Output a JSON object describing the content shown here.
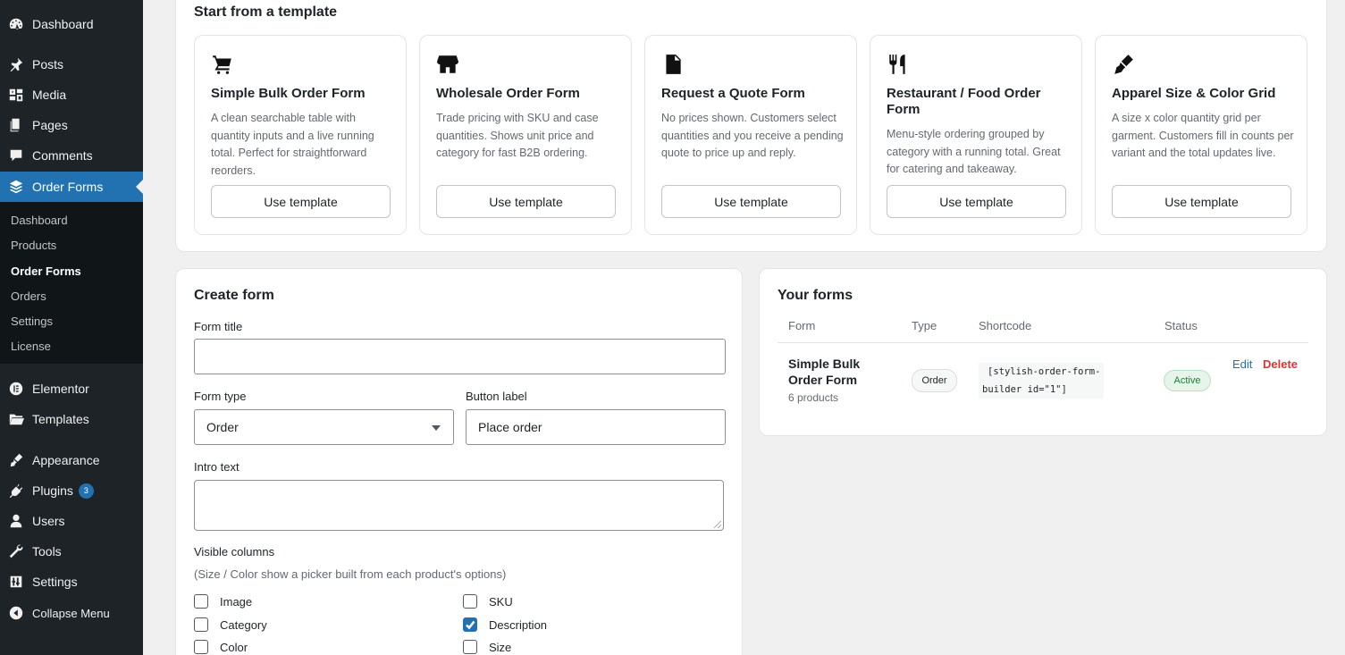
{
  "sidebar": {
    "items": [
      {
        "label": "Dashboard",
        "icon": "dashboard-icon"
      },
      {
        "label": "Posts",
        "icon": "pin-icon"
      },
      {
        "label": "Media",
        "icon": "media-icon"
      },
      {
        "label": "Pages",
        "icon": "pages-icon"
      },
      {
        "label": "Comments",
        "icon": "comment-icon"
      },
      {
        "label": "Order Forms",
        "icon": "stack-icon"
      },
      {
        "label": "Elementor",
        "icon": "elementor-icon"
      },
      {
        "label": "Templates",
        "icon": "folder-icon"
      },
      {
        "label": "Appearance",
        "icon": "brush-icon"
      },
      {
        "label": "Plugins",
        "icon": "plugin-icon",
        "badge": "3"
      },
      {
        "label": "Users",
        "icon": "user-icon"
      },
      {
        "label": "Tools",
        "icon": "wrench-icon"
      },
      {
        "label": "Settings",
        "icon": "settings-icon"
      },
      {
        "label": "Collapse Menu",
        "icon": "collapse-icon"
      }
    ],
    "submenu": [
      "Dashboard",
      "Products",
      "Order Forms",
      "Orders",
      "Settings",
      "License"
    ]
  },
  "templates": {
    "title": "Start from a template",
    "cards": [
      {
        "name": "Simple Bulk Order Form",
        "icon": "cart-icon",
        "desc": "A clean searchable table with quantity inputs and a live running total. Perfect for straightforward reorders.",
        "button": "Use template"
      },
      {
        "name": "Wholesale Order Form",
        "icon": "store-icon",
        "desc": "Trade pricing with SKU and case quantities. Shows unit price and category for fast B2B ordering.",
        "button": "Use template"
      },
      {
        "name": "Request a Quote Form",
        "icon": "document-icon",
        "desc": "No prices shown. Customers select quantities and you receive a pending quote to price up and reply.",
        "button": "Use template"
      },
      {
        "name": "Restaurant / Food Order Form",
        "icon": "utensils-icon",
        "desc": "Menu-style ordering grouped by category with a running total. Great for catering and takeaway.",
        "button": "Use template"
      },
      {
        "name": "Apparel Size & Color Grid",
        "icon": "brush-icon",
        "desc": "A size x color quantity grid per garment. Customers fill in counts per variant and the total updates live.",
        "button": "Use template"
      }
    ]
  },
  "create_form": {
    "title": "Create form",
    "form_title_label": "Form title",
    "form_title_value": "",
    "form_type_label": "Form type",
    "form_type_value": "Order",
    "button_label_label": "Button label",
    "button_label_value": "Place order",
    "intro_label": "Intro text",
    "intro_value": "",
    "visible_columns_label": "Visible columns",
    "visible_columns_hint": "(Size / Color show a picker built from each product's options)",
    "columns": [
      {
        "label": "Image",
        "checked": false
      },
      {
        "label": "SKU",
        "checked": false
      },
      {
        "label": "Category",
        "checked": false
      },
      {
        "label": "Description",
        "checked": true
      },
      {
        "label": "Color",
        "checked": false
      },
      {
        "label": "Size",
        "checked": false
      }
    ]
  },
  "your_forms": {
    "title": "Your forms",
    "headers": [
      "Form",
      "Type",
      "Shortcode",
      "Status"
    ],
    "rows": [
      {
        "name_line1": "Simple Bulk",
        "name_line2": "Order Form",
        "count": "6 products",
        "type": "Order",
        "shortcode_line1": "[stylish-order-form-",
        "shortcode_line2": "builder id=\"1\"]",
        "status": "Active",
        "edit": "Edit",
        "delete": "Delete"
      }
    ]
  },
  "colors": {
    "accent": "#2271b1",
    "danger": "#d63638",
    "active_green": "#1e7e34",
    "active_bg": "#e6f4ea",
    "sidebar_bg": "#1d2327"
  }
}
